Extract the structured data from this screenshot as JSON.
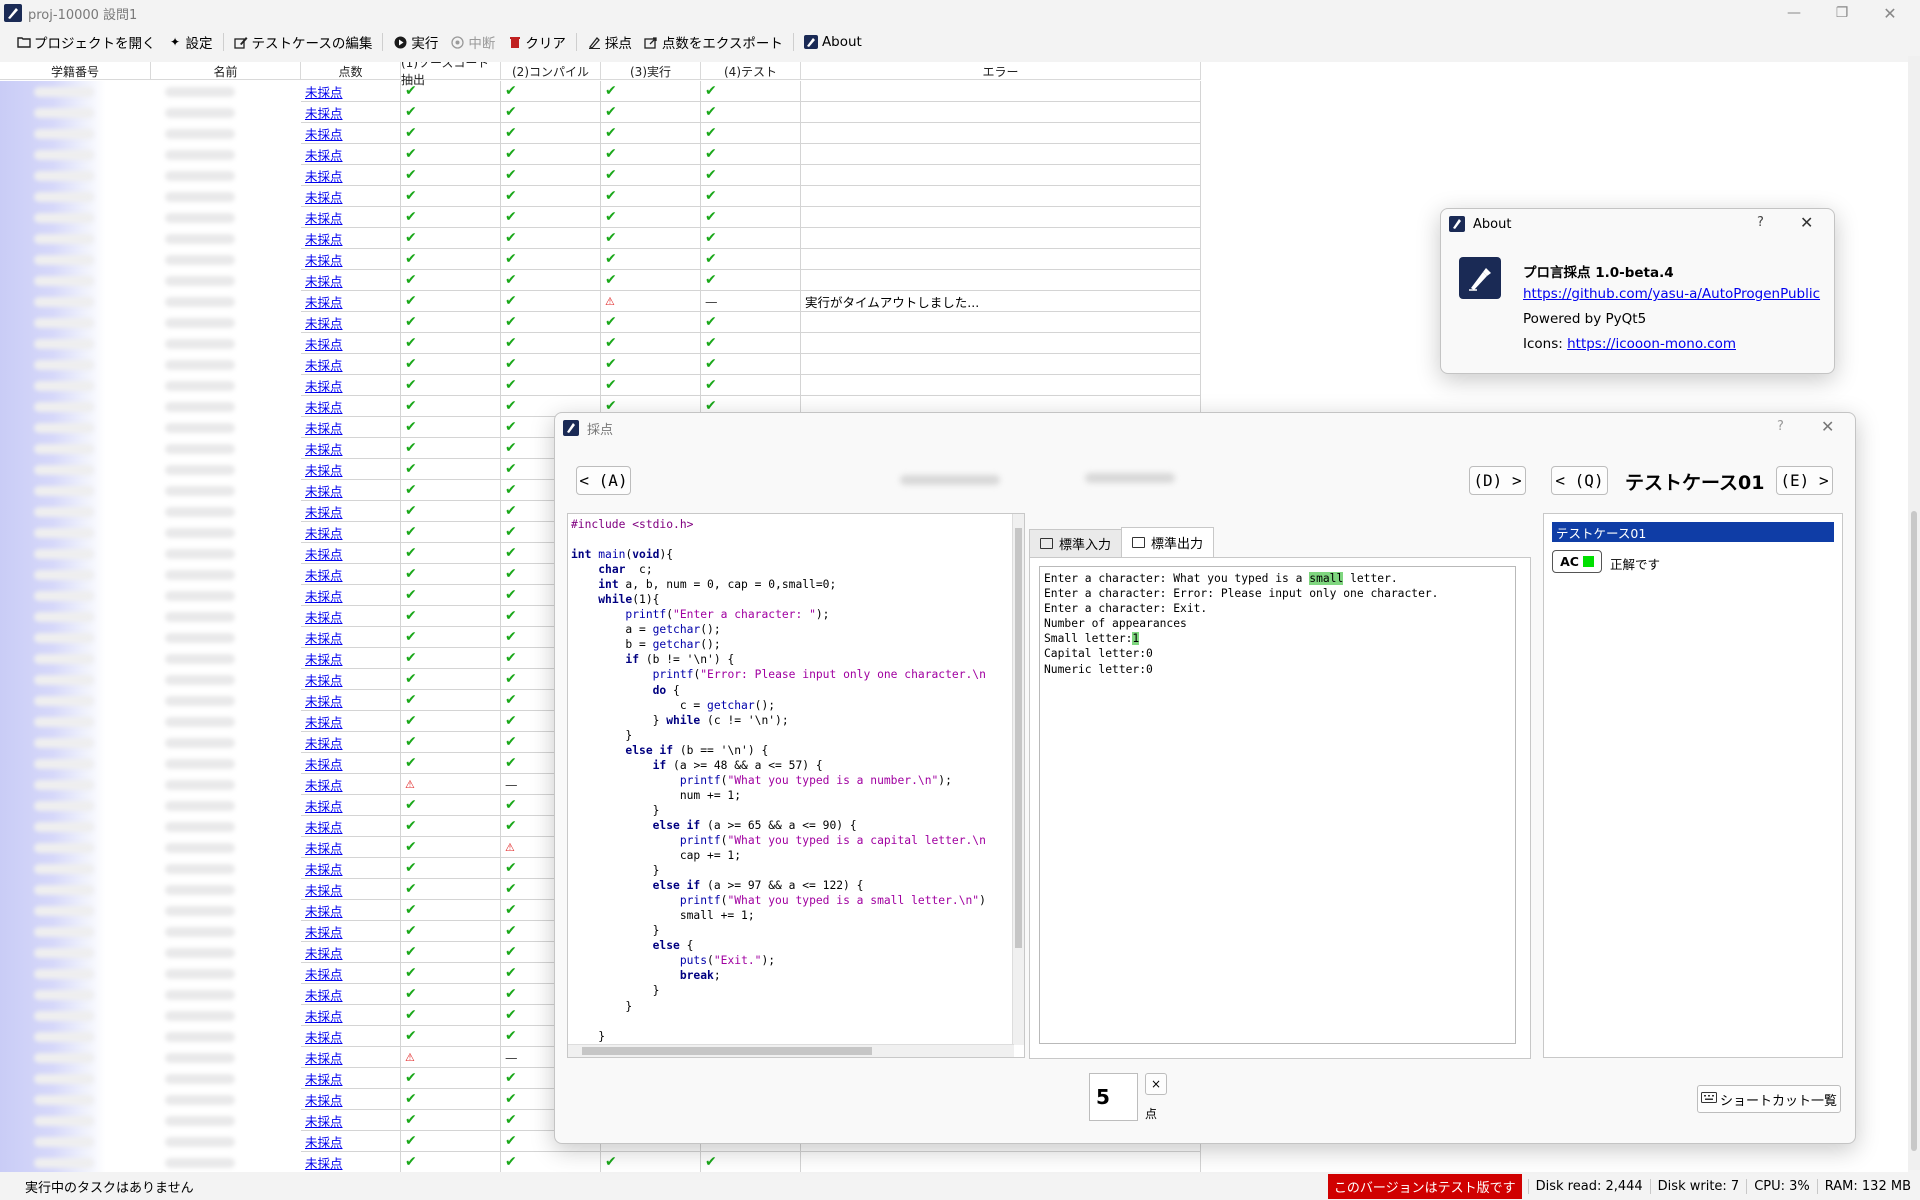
{
  "window": {
    "title": "proj-10000 設問1"
  },
  "toolbar": {
    "open_project": "プロジェクトを開く",
    "settings": "設定",
    "edit_testcases": "テストケースの編集",
    "run": "実行",
    "stop": "中断",
    "clear": "クリア",
    "grade": "採点",
    "export": "点数をエクスポート",
    "about": "About"
  },
  "table": {
    "headers": [
      "学籍番号",
      "名前",
      "点数",
      "(1)ソースコード抽出",
      "(2)コンパイル",
      "(3)実行",
      "(4)テスト",
      "エラー"
    ],
    "score_link": "未採点",
    "timeout_error": "実行がタイムアウトしました..."
  },
  "status": {
    "message": "実行中のタスクはありません",
    "test_version": "このバージョンはテスト版です",
    "disk_read": "Disk read: 2,444",
    "disk_write": "Disk write: 7",
    "cpu": "CPU: 3%",
    "ram": "RAM: 132 MB"
  },
  "about": {
    "title": "About",
    "help": "?",
    "app_name": "プロ言採点 1.0-beta.4",
    "repo_link": "https://github.com/yasu-a/AutoProgenPublic",
    "powered": "Powered by PyQt5",
    "icons_label": "Icons: ",
    "icons_link": "https://icooon-mono.com"
  },
  "grading": {
    "title": "採点",
    "help": "?",
    "prev_student": "< (A)",
    "next_student": "(D) >",
    "prev_case": "< (Q)",
    "next_case": "(E) >",
    "testcase_title": "テストケース01",
    "tab_stdin": "標準入力",
    "tab_stdout": "標準出力",
    "testcase_item": "テストケース01",
    "ac_label": "AC",
    "ac_text": "正解です",
    "score": "5",
    "score_unit": "点",
    "clear_score": "×",
    "shortcuts": "ショートカット一覧"
  },
  "colors": {
    "check": "#1aa81a",
    "warn": "#e02020",
    "selection": "#0f3da6",
    "accept": "#00e000",
    "test_version_bg": "#d00000"
  }
}
